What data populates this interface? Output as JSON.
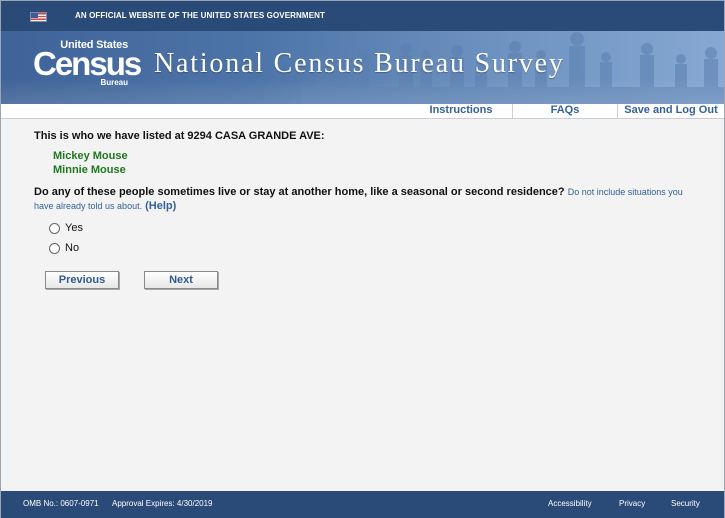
{
  "gov_banner": {
    "flag_icon": "us-flag-icon",
    "text": "AN OFFICIAL WEBSITE OF THE UNITED STATES GOVERNMENT"
  },
  "header": {
    "logo_top": "United States",
    "logo_main": "Census",
    "logo_bottom": "Bureau",
    "title": "National Census Bureau Survey"
  },
  "nav": {
    "instructions": "Instructions",
    "faqs": "FAQs",
    "save_logout": "Save and Log Out"
  },
  "main": {
    "heading": "This is who we have listed at 9294 CASA GRANDE AVE:",
    "people": [
      "Mickey Mouse",
      "Minnie Mouse"
    ],
    "question": "Do any of these people sometimes live or stay at another home, like a seasonal or second residence?",
    "question_note": "Do not include situations you have already told us about.",
    "help_link": "(Help)",
    "options": [
      "Yes",
      "No"
    ],
    "selected_option": null
  },
  "buttons": {
    "previous": "Previous",
    "next": "Next"
  },
  "footer": {
    "omb": "OMB No.: 0607-0971",
    "approval": "Approval Expires: 4/30/2019",
    "links": [
      "Accessibility",
      "Privacy",
      "Security"
    ]
  },
  "colors": {
    "header_blue": "#2a4a78",
    "link_blue": "#33629a",
    "person_green": "#1c7a1c"
  }
}
